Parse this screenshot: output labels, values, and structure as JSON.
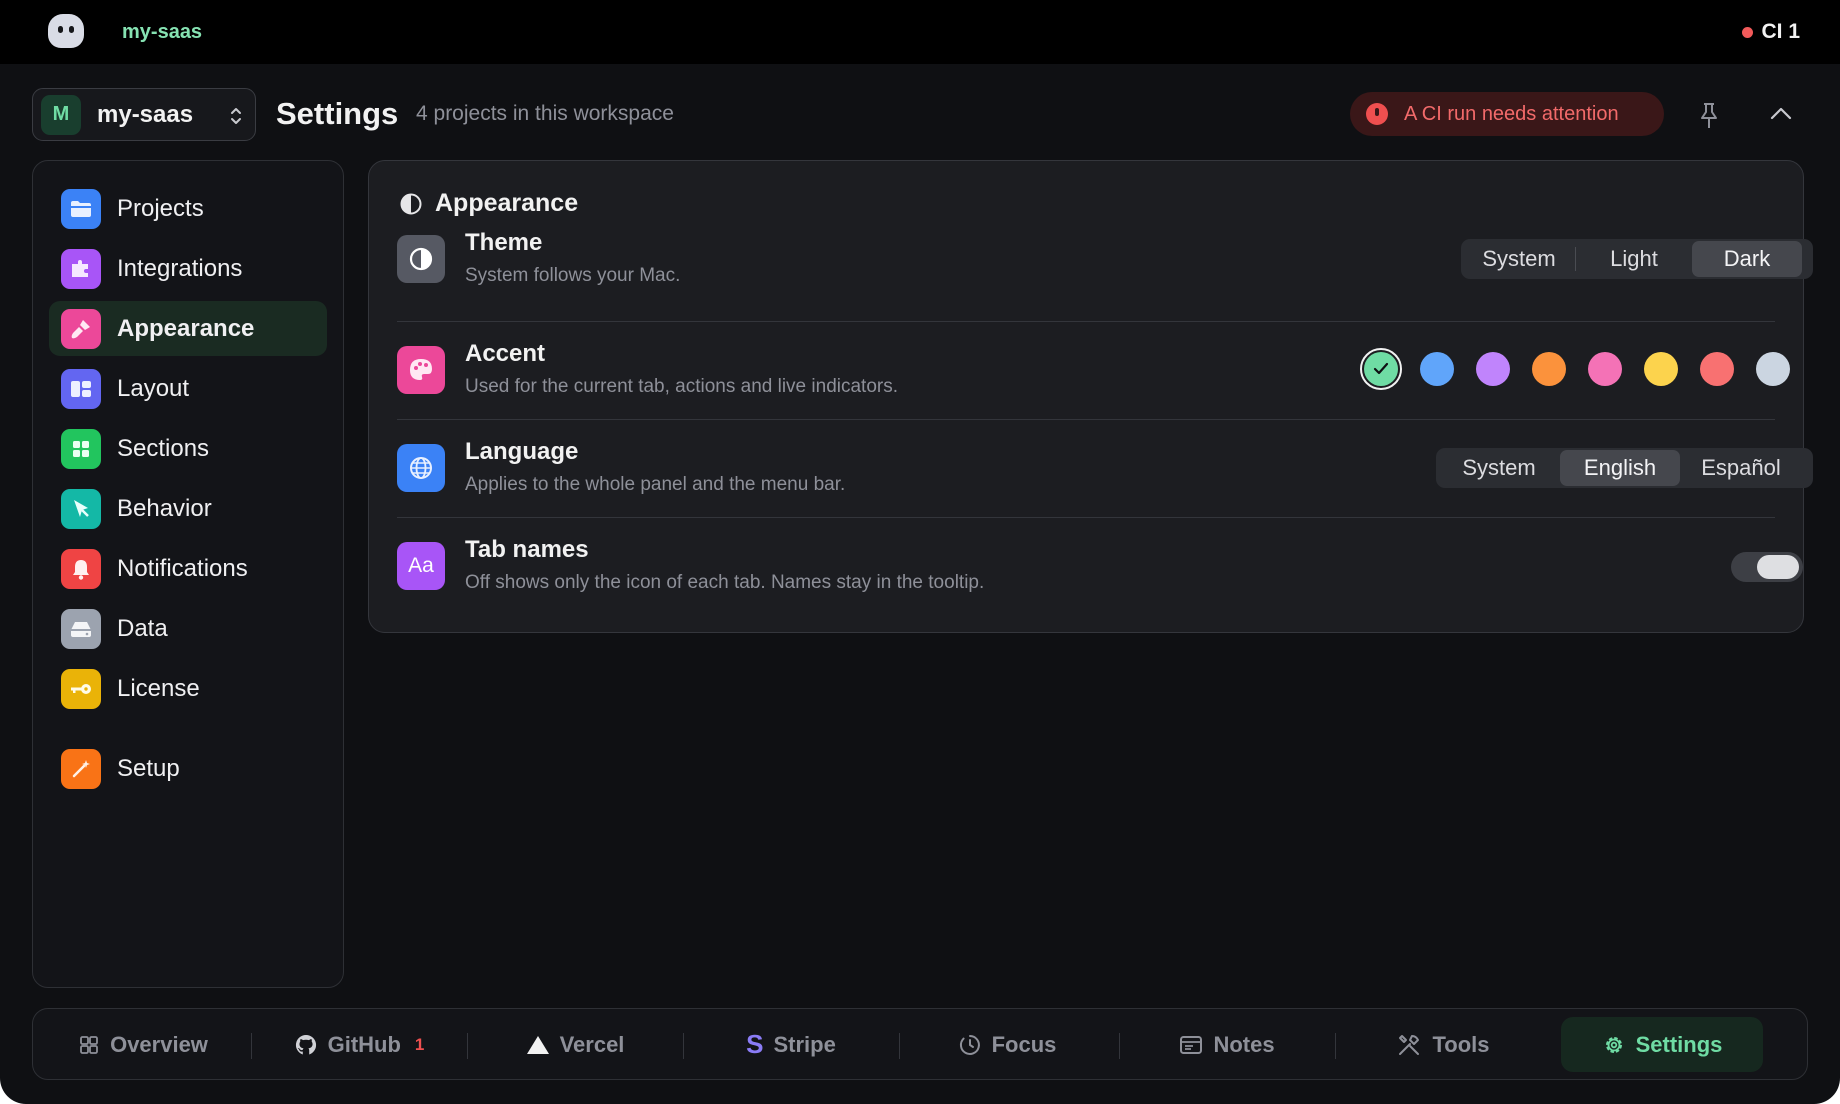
{
  "menubar": {
    "app_name": "my-saas",
    "ci_label": "CI 1"
  },
  "header": {
    "workspace": {
      "initial": "M",
      "name": "my-saas"
    },
    "title": "Settings",
    "subtitle": "4 projects in this workspace",
    "alert": "A CI run needs attention"
  },
  "sidebar": {
    "items": [
      {
        "label": "Projects",
        "icon": "folder-icon",
        "color": "#3b82f6"
      },
      {
        "label": "Integrations",
        "icon": "puzzle-icon",
        "color": "#a855f7"
      },
      {
        "label": "Appearance",
        "icon": "brush-icon",
        "color": "#ec4899",
        "active": true
      },
      {
        "label": "Layout",
        "icon": "layout-icon",
        "color": "#6366f1"
      },
      {
        "label": "Sections",
        "icon": "grid-icon",
        "color": "#22c55e"
      },
      {
        "label": "Behavior",
        "icon": "cursor-icon",
        "color": "#14b8a6"
      },
      {
        "label": "Notifications",
        "icon": "bell-icon",
        "color": "#ef4444"
      },
      {
        "label": "Data",
        "icon": "drive-icon",
        "color": "#9ca3af"
      },
      {
        "label": "License",
        "icon": "key-icon",
        "color": "#eab308"
      },
      {
        "label": "Setup",
        "icon": "wand-icon",
        "color": "#f97316"
      }
    ]
  },
  "appearance": {
    "title": "Appearance",
    "theme": {
      "title": "Theme",
      "description": "System follows your Mac.",
      "options": [
        "System",
        "Light",
        "Dark"
      ],
      "selected": "Dark"
    },
    "accent": {
      "title": "Accent",
      "description": "Used for the current tab, actions and live indicators.",
      "colors": [
        "#6fdca4",
        "#60a5fa",
        "#c084fc",
        "#fb923c",
        "#f472b6",
        "#fcd34d",
        "#f87171",
        "#cbd5e1"
      ],
      "selected": "#6fdca4"
    },
    "language": {
      "title": "Language",
      "description": "Applies to the whole panel and the menu bar.",
      "options": [
        "System",
        "English",
        "Español"
      ],
      "selected": "English"
    },
    "tab_names": {
      "title": "Tab names",
      "description": "Off shows only the icon of each tab. Names stay in the tooltip.",
      "enabled": true
    }
  },
  "tabbar": {
    "tabs": [
      {
        "label": "Overview",
        "icon": "grid-icon"
      },
      {
        "label": "GitHub",
        "icon": "github-icon",
        "count": "1"
      },
      {
        "label": "Vercel",
        "icon": "triangle-icon"
      },
      {
        "label": "Stripe",
        "icon": "stripe-icon"
      },
      {
        "label": "Focus",
        "icon": "timer-icon"
      },
      {
        "label": "Notes",
        "icon": "notes-icon"
      },
      {
        "label": "Tools",
        "icon": "tools-icon"
      },
      {
        "label": "Settings",
        "icon": "gear-icon",
        "active": true
      }
    ]
  }
}
